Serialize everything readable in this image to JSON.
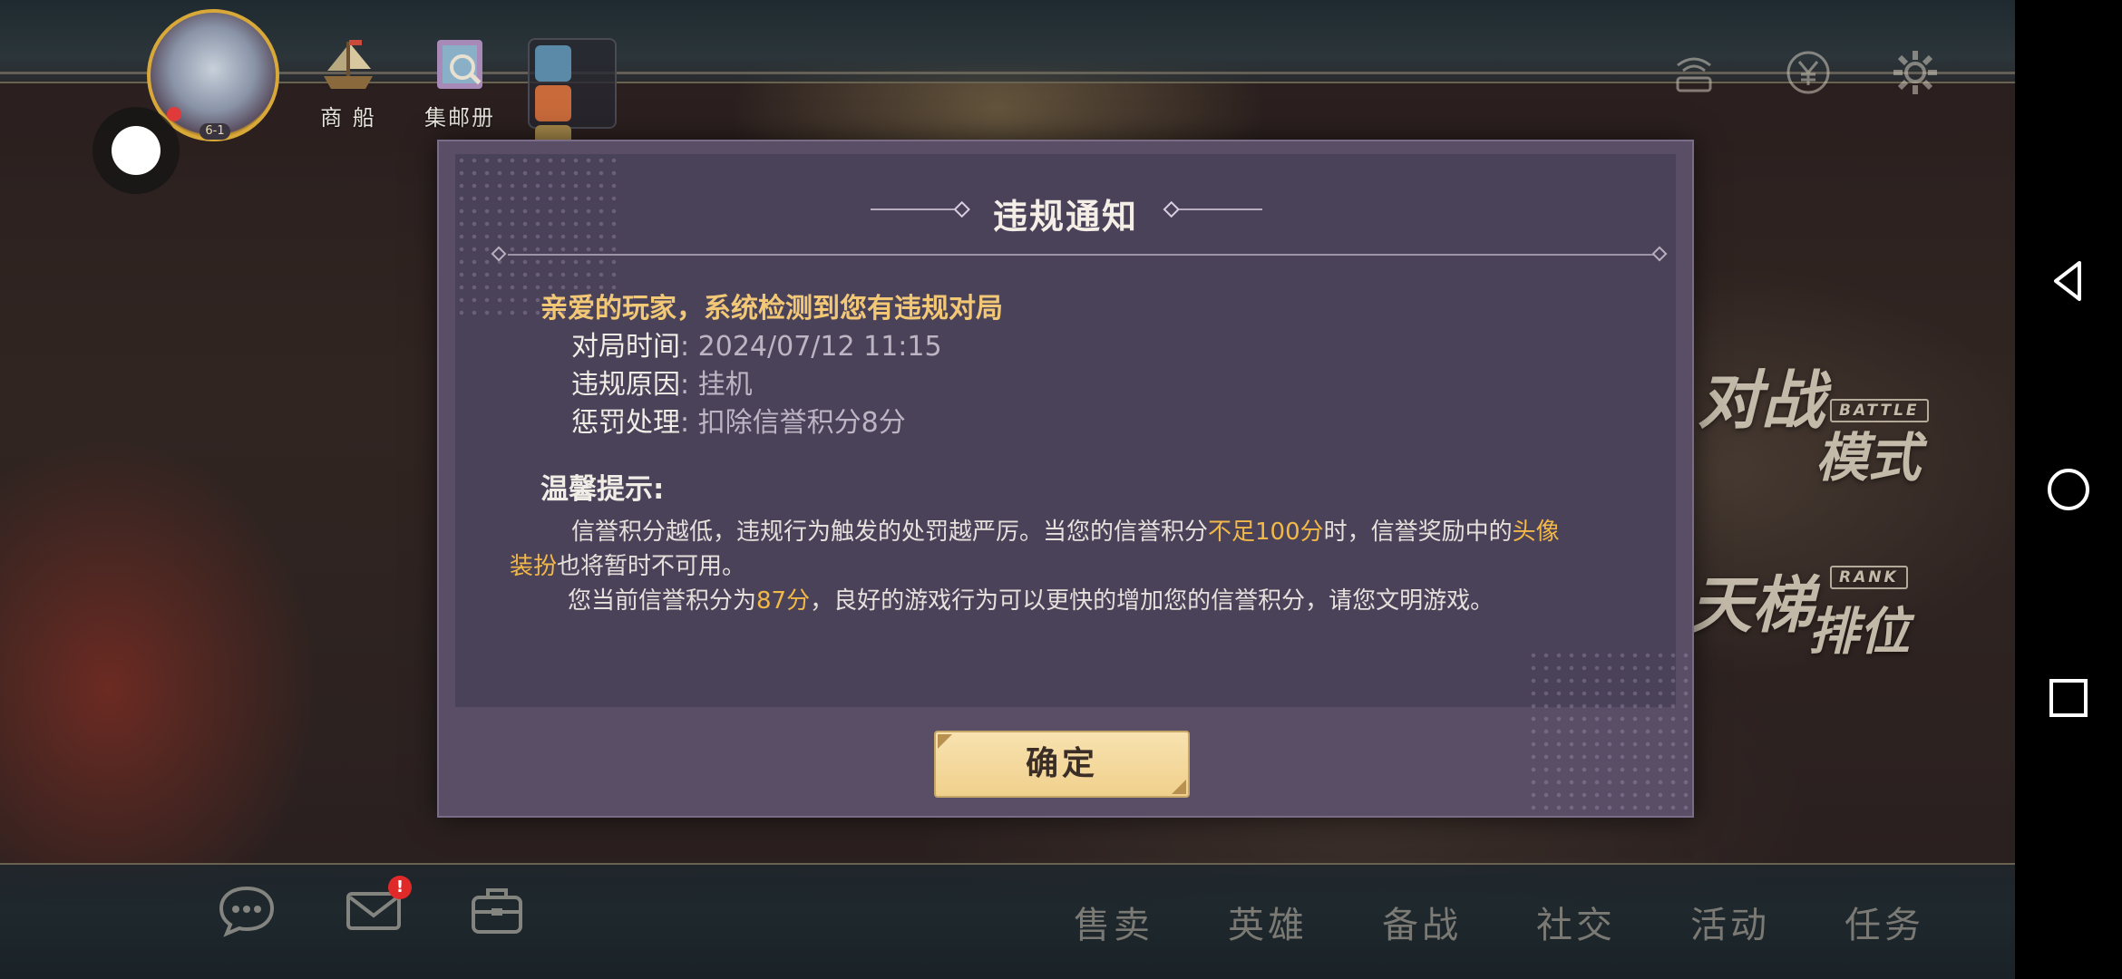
{
  "hud": {
    "avatar_level": "6-1",
    "shop_label": "商 船",
    "album_label": "集邮册"
  },
  "modes": {
    "battle_title_1": "对战",
    "battle_title_2": "模式",
    "battle_tag": "BATTLE",
    "rank_title_1": "天梯",
    "rank_title_2": "排位",
    "rank_tag": "RANK"
  },
  "dialog": {
    "title": "违规通知",
    "greeting": "亲爱的玩家，系统检测到您有违规对局",
    "rows": [
      {
        "label": "对局时间",
        "sep": ": ",
        "value": "2024/07/12 11:15"
      },
      {
        "label": "违规原因",
        "sep": ": ",
        "value": "挂机"
      },
      {
        "label": "惩罚处理",
        "sep": ": ",
        "value": "扣除信誉积分8分"
      }
    ],
    "tips_title": "温馨提示:",
    "tip1_part1": "信誉积分越低，违规行为触发的处罚越严厉。当您的信誉积分",
    "tip1_hl1": "不足100分",
    "tip1_part2": "时，信誉奖励中的",
    "tip1_hl2a": "头像",
    "tip1_hl2b": "装扮",
    "tip1_part3": "也将暂时不可用。",
    "tip2_part1": "您当前信誉积分为",
    "tip2_hl": "87分",
    "tip2_part2": "，良好的游戏行为可以更快的增加您的信誉积分，请您文明游戏。",
    "confirm_label": "确定"
  },
  "notifications": {
    "mail_badge": "!"
  },
  "bottom_menu": [
    "售卖",
    "英雄",
    "备战",
    "社交",
    "活动",
    "任务"
  ],
  "colors": {
    "highlight": "#f2b848",
    "greeting": "#f2c877",
    "dialog_bg": "#4a4258",
    "button_bg": "#f0d08c"
  }
}
